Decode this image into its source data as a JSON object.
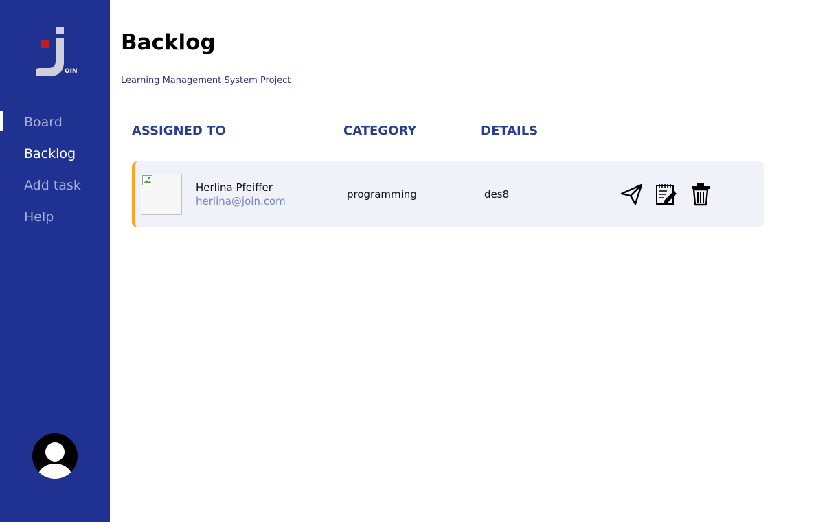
{
  "sidebar": {
    "logo": {
      "text": "OIN",
      "colors": {
        "j": "#d0d0dc",
        "square": "#c01f1f",
        "background": "#1f3191"
      }
    },
    "items": [
      {
        "label": "Board",
        "active": false
      },
      {
        "label": "Backlog",
        "active": true
      },
      {
        "label": "Add task",
        "active": false
      },
      {
        "label": "Help",
        "active": false
      }
    ],
    "avatar_icon": "user-silhouette-icon"
  },
  "main": {
    "title": "Backlog",
    "subtitle": "Learning Management System Project",
    "columns": [
      "ASSIGNED TO",
      "CATEGORY",
      "DETAILS"
    ],
    "tasks": [
      {
        "name": "Herlina Pfeiffer",
        "email": "herlina@join.com",
        "category": "programming",
        "details": "des8",
        "accent_color": "#f5a623",
        "actions": [
          "send-icon",
          "edit-note-icon",
          "trash-icon"
        ]
      }
    ]
  },
  "colors": {
    "sidebar": "#1f3191",
    "header_text": "#2a3d8f",
    "card_background": "#f1f1f9",
    "email": "#7187c8"
  }
}
